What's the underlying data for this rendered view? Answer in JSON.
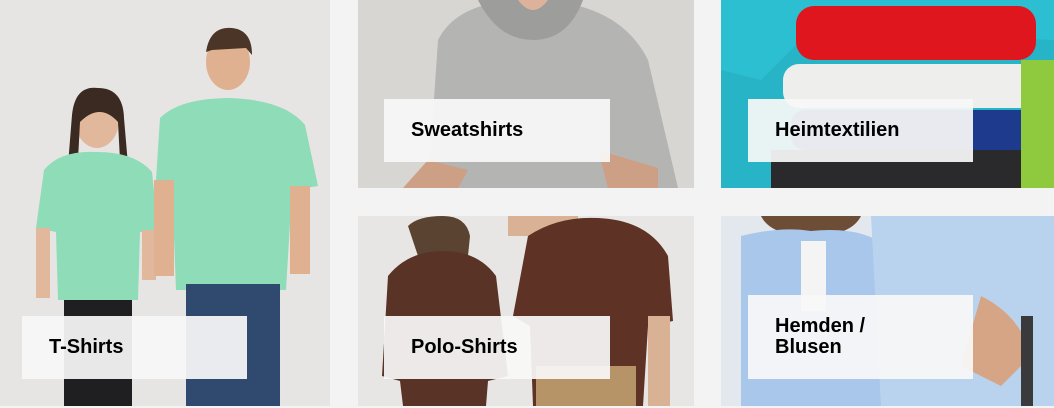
{
  "categories": [
    {
      "id": "tshirts",
      "label": "T-Shirts"
    },
    {
      "id": "sweatshirts",
      "label": "Sweatshirts"
    },
    {
      "id": "heimtextilien",
      "label": "Heimtextilien"
    },
    {
      "id": "poloshirts",
      "label": "Polo-Shirts"
    },
    {
      "id": "hemden",
      "label": "Hemden /\nBlusen"
    }
  ]
}
